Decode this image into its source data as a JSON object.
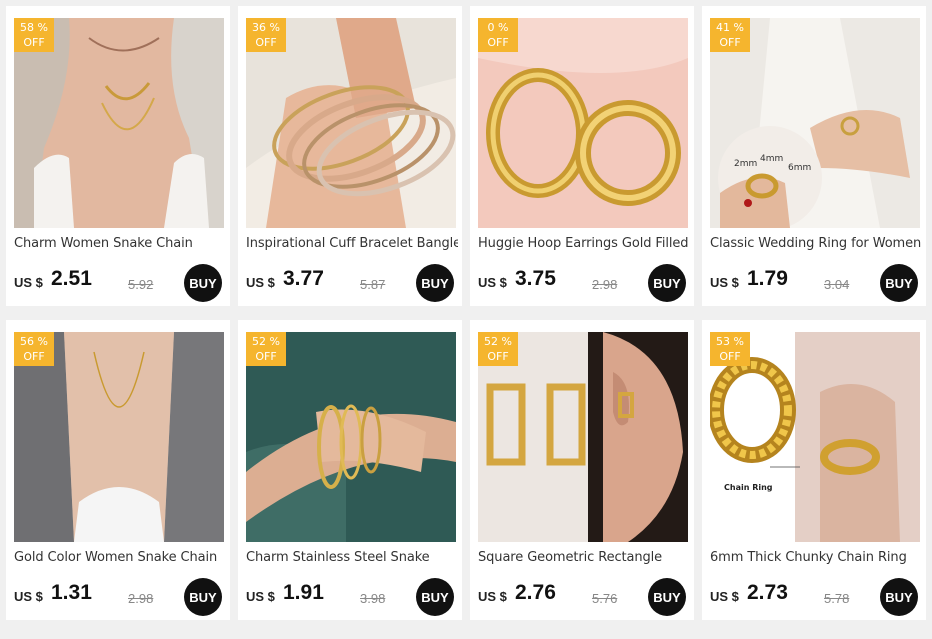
{
  "currency_label": "US $",
  "buy_label": "BUY",
  "products": [
    {
      "discount": "58 %",
      "off": "OFF",
      "title": "Charm Women Snake Chain",
      "price": "2.51",
      "original_price": "5.92",
      "image": "woman-wearing-gold-snake-chain-necklace"
    },
    {
      "discount": "36 %",
      "off": "OFF",
      "title": "Inspirational Cuff Bracelet Bangle",
      "price": "3.77",
      "original_price": "5.87",
      "image": "wrist-with-stacked-cuff-bangles"
    },
    {
      "discount": "0  %",
      "off": "OFF",
      "title": "Huggie Hoop Earrings Gold Filled",
      "price": "3.75",
      "original_price": "2.98",
      "image": "gold-hoop-earrings-on-pink"
    },
    {
      "discount": "41 %",
      "off": "OFF",
      "title": "Classic Wedding Ring for Women",
      "price": "1.79",
      "original_price": "3.04",
      "image": "hand-with-gold-rings-size-options"
    },
    {
      "discount": "56 %",
      "off": "OFF",
      "title": "Gold Color Women Snake Chain",
      "price": "1.31",
      "original_price": "2.98",
      "image": "woman-in-grey-blazer-with-chain"
    },
    {
      "discount": "52 %",
      "off": "OFF",
      "title": "Charm Stainless Steel Snake",
      "price": "1.91",
      "original_price": "3.98",
      "image": "wrist-with-chain-bracelets"
    },
    {
      "discount": "52 %",
      "off": "OFF",
      "title": "Square Geometric Rectangle",
      "price": "2.76",
      "original_price": "5.76",
      "image": "square-hoop-earrings-on-model"
    },
    {
      "discount": "53 %",
      "off": "OFF",
      "title": "6mm Thick Chunky Chain Ring",
      "price": "2.73",
      "original_price": "5.78",
      "image": "chunky-chain-ring-on-finger"
    }
  ],
  "ring_sizes": [
    "2mm",
    "4mm",
    "6mm"
  ],
  "chain_ring_label": "Chain Ring",
  "colors": {
    "badge": "#f5b52e",
    "buy": "#111111",
    "page_bg": "#f0f0f0"
  }
}
